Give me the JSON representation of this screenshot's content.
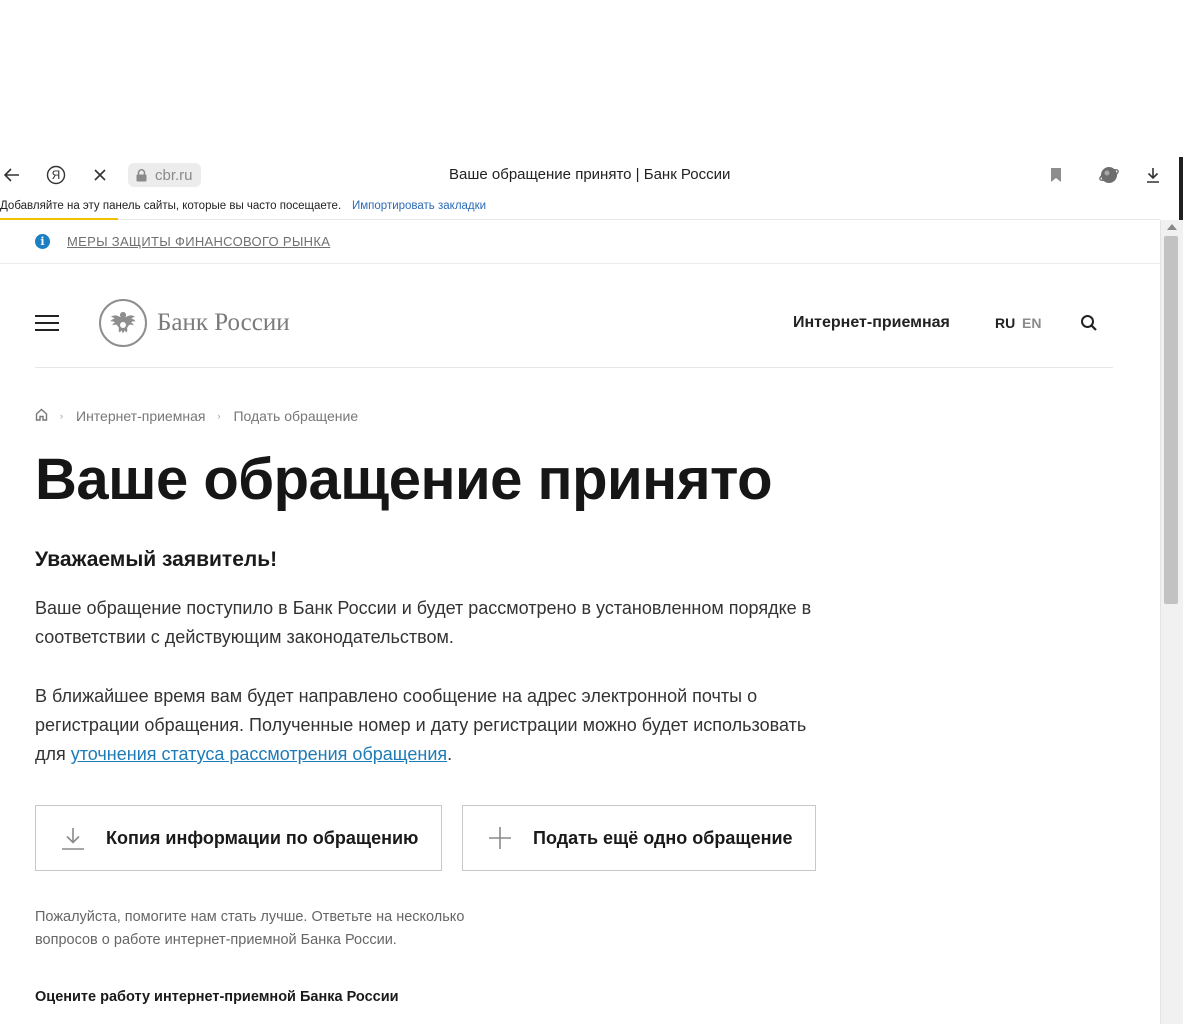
{
  "browser": {
    "url": "cbr.ru",
    "tab_title": "Ваше обращение принято | Банк России",
    "bookmarks_hint": "Добавляйте на эту панель сайты, которые вы часто посещаете.",
    "bookmarks_import": "Импортировать закладки",
    "yandex_glyph": "Я"
  },
  "notice": {
    "text": "МЕРЫ ЗАЩИТЫ ФИНАНСОВОГО РЫНКА",
    "icon": "i"
  },
  "header": {
    "logo_text": "Банк России",
    "reception_link": "Интернет-приемная",
    "lang_ru": "RU",
    "lang_en": "EN"
  },
  "breadcrumb": {
    "items": [
      "Интернет-приемная",
      "Подать обращение"
    ]
  },
  "main": {
    "title": "Ваше обращение принято",
    "greeting": "Уважаемый заявитель!",
    "paragraph1": "Ваше обращение поступило в Банк России и будет рассмотрено в установленном порядке в соответствии с действующим законодательством.",
    "paragraph2_before": "В ближайшее время вам будет направлено сообщение на адрес электронной почты о регистрации обращения. Полученные номер и дату регистрации можно будет использовать для ",
    "paragraph2_link": "уточнения статуса рассмотрения обращения",
    "paragraph2_after": ".",
    "button_copy": "Копия информации по обращению",
    "button_new": "Подать ещё одно обращение",
    "survey_note": "Пожалуйста, помогите нам стать лучше. Ответьте на несколько вопросов о работе интернет-приемной Банка России.",
    "survey_heading": "Оцените работу интернет-приемной Банка России"
  },
  "colors": {
    "accent_link": "#1e7bb8",
    "info_icon": "#1b7fc4",
    "loading_bar": "#f2c200"
  }
}
